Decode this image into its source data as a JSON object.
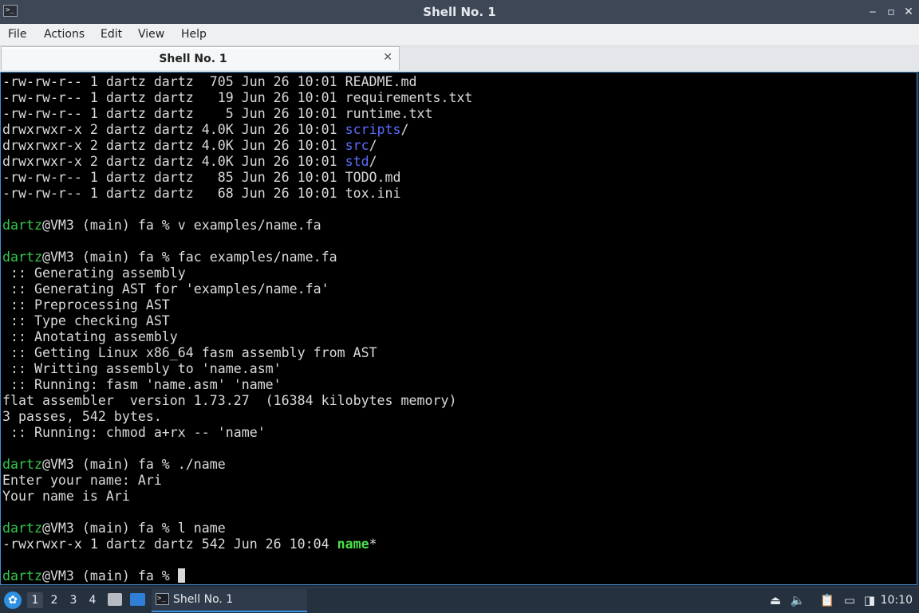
{
  "window": {
    "title": "Shell No. 1",
    "minimize_glyph": "‒",
    "restore_glyph": "▫",
    "maximize_glyph": "⤢",
    "close_glyph": "✕"
  },
  "menu": {
    "items": [
      "File",
      "Actions",
      "Edit",
      "View",
      "Help"
    ]
  },
  "tab": {
    "label": "Shell No. 1",
    "close_glyph": "✕"
  },
  "terminal": {
    "lines": [
      [
        {
          "t": "-rw-rw-r-- 1 dartz dartz  705 Jun 26 10:01 README.md"
        }
      ],
      [
        {
          "t": "-rw-rw-r-- 1 dartz dartz   19 Jun 26 10:01 requirements.txt"
        }
      ],
      [
        {
          "t": "-rw-rw-r-- 1 dartz dartz    5 Jun 26 10:01 runtime.txt"
        }
      ],
      [
        {
          "t": "drwxrwxr-x 2 dartz dartz 4.0K Jun 26 10:01 "
        },
        {
          "t": "scripts",
          "c": "dir"
        },
        {
          "t": "/"
        }
      ],
      [
        {
          "t": "drwxrwxr-x 2 dartz dartz 4.0K Jun 26 10:01 "
        },
        {
          "t": "src",
          "c": "dir"
        },
        {
          "t": "/"
        }
      ],
      [
        {
          "t": "drwxrwxr-x 2 dartz dartz 4.0K Jun 26 10:01 "
        },
        {
          "t": "std",
          "c": "dir"
        },
        {
          "t": "/"
        }
      ],
      [
        {
          "t": "-rw-rw-r-- 1 dartz dartz   85 Jun 26 10:01 TODO.md"
        }
      ],
      [
        {
          "t": "-rw-rw-r-- 1 dartz dartz   68 Jun 26 10:01 tox.ini"
        }
      ],
      [],
      [
        {
          "t": "dartz",
          "c": "user"
        },
        {
          "t": "@VM3 (main) fa % v examples/name.fa"
        }
      ],
      [],
      [
        {
          "t": "dartz",
          "c": "user"
        },
        {
          "t": "@VM3 (main) fa % fac examples/name.fa"
        }
      ],
      [
        {
          "t": " :: Generating assembly"
        }
      ],
      [
        {
          "t": " :: Generating AST for 'examples/name.fa'"
        }
      ],
      [
        {
          "t": " :: Preprocessing AST"
        }
      ],
      [
        {
          "t": " :: Type checking AST"
        }
      ],
      [
        {
          "t": " :: Anotating assembly"
        }
      ],
      [
        {
          "t": " :: Getting Linux x86_64 fasm assembly from AST"
        }
      ],
      [
        {
          "t": " :: Writting assembly to 'name.asm'"
        }
      ],
      [
        {
          "t": " :: Running: fasm 'name.asm' 'name'"
        }
      ],
      [
        {
          "t": "flat assembler  version 1.73.27  (16384 kilobytes memory)"
        }
      ],
      [
        {
          "t": "3 passes, 542 bytes."
        }
      ],
      [
        {
          "t": " :: Running: chmod a+rx -- 'name'"
        }
      ],
      [],
      [
        {
          "t": "dartz",
          "c": "user"
        },
        {
          "t": "@VM3 (main) fa % ./name"
        }
      ],
      [
        {
          "t": "Enter your name: Ari"
        }
      ],
      [
        {
          "t": "Your name is Ari"
        }
      ],
      [],
      [
        {
          "t": "dartz",
          "c": "user"
        },
        {
          "t": "@VM3 (main) fa % l name"
        }
      ],
      [
        {
          "t": "-rwxrwxr-x 1 dartz dartz 542 Jun 26 10:04 "
        },
        {
          "t": "name",
          "c": "exe"
        },
        {
          "t": "*"
        }
      ],
      [],
      [
        {
          "t": "dartz",
          "c": "user"
        },
        {
          "t": "@VM3 (main) fa % "
        },
        {
          "cursor": true
        }
      ]
    ]
  },
  "taskbar": {
    "workspaces": [
      "1",
      "2",
      "3",
      "4"
    ],
    "active_workspace": "1",
    "task_label": "Shell No. 1",
    "clock": "10:10",
    "tray_icons": [
      "eject-icon",
      "volume-icon",
      "clipboard-icon",
      "network-icon",
      "notification-icon"
    ]
  },
  "colors": {
    "user_prompt": "#35c84a",
    "directory": "#5b6cff",
    "executable": "#4ae04a",
    "terminal_bg": "#000000",
    "terminal_fg": "#dadada",
    "accent": "#3d8fe0"
  }
}
